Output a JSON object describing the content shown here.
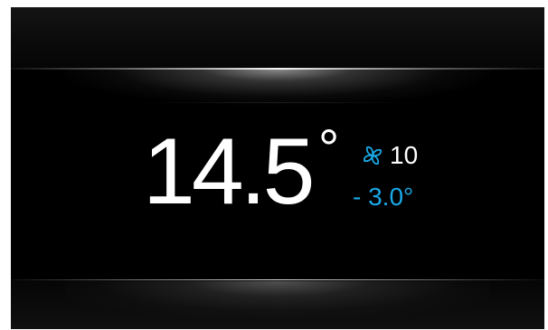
{
  "display": {
    "temperature": "14.5",
    "degree_symbol": "°",
    "fan": {
      "icon": "fan-icon",
      "value": "10"
    },
    "offset": "- 3.0°",
    "colors": {
      "background": "#000000",
      "primary_text": "#ffffff",
      "accent": "#1aa8e6"
    }
  }
}
